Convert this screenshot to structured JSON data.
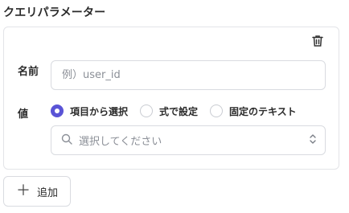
{
  "section": {
    "title": "クエリパラメーター"
  },
  "param": {
    "name_label": "名前",
    "name_placeholder": "例）user_id",
    "value_label": "値",
    "value_modes": [
      {
        "label": "項目から選択",
        "selected": true
      },
      {
        "label": "式で設定",
        "selected": false
      },
      {
        "label": "固定のテキスト",
        "selected": false
      }
    ],
    "select_placeholder": "選択してください"
  },
  "actions": {
    "add_label": "追加",
    "add_icon": "plus-icon",
    "delete_icon": "trash-icon",
    "search_icon": "search-icon",
    "sort_icon": "chevron-up-down-icon"
  },
  "colors": {
    "accent": "#5a54d6",
    "border": "#d9dbe0",
    "placeholder": "#8b8f97"
  }
}
